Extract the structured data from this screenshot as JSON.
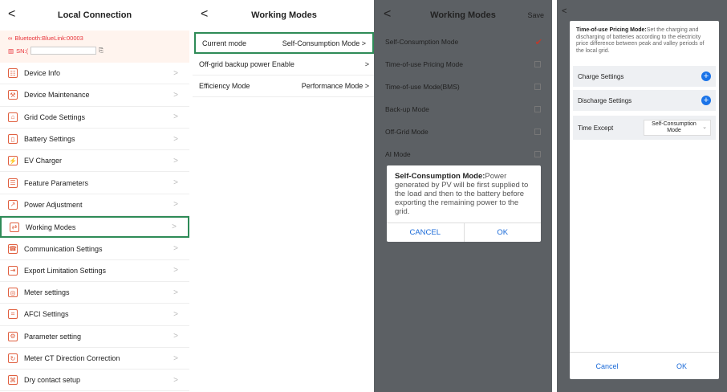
{
  "p1": {
    "title": "Local Connection",
    "back": "<",
    "bluetooth": "Bluetooth:BlueLink:00003",
    "sn_label": "SN:(",
    "items": [
      {
        "label": "Device Info",
        "icon": "☷"
      },
      {
        "label": "Device Maintenance",
        "icon": "⚒"
      },
      {
        "label": "Grid Code Settings",
        "icon": "⌂"
      },
      {
        "label": "Battery Settings",
        "icon": "▯"
      },
      {
        "label": "EV Charger",
        "icon": "⚡"
      },
      {
        "label": "Feature Parameters",
        "icon": "☰"
      },
      {
        "label": "Power Adjustment",
        "icon": "↗"
      },
      {
        "label": "Working Modes",
        "icon": "⇄"
      },
      {
        "label": "Communication Settings",
        "icon": "☎"
      },
      {
        "label": "Export Limitation Settings",
        "icon": "⇥"
      },
      {
        "label": "Meter settings",
        "icon": "◎"
      },
      {
        "label": "AFCI Settings",
        "icon": "⌗"
      },
      {
        "label": "Parameter setting",
        "icon": "⚙"
      },
      {
        "label": "Meter CT Direction Correction",
        "icon": "↻"
      },
      {
        "label": "Dry contact setup",
        "icon": "⌘"
      }
    ],
    "chevron": ">"
  },
  "p2": {
    "title": "Working Modes",
    "back": "<",
    "rows": [
      {
        "label": "Current mode",
        "value": "Self-Consumption Mode  >"
      },
      {
        "label": "Off-grid backup power Enable",
        "value": ">"
      },
      {
        "label": "Efficiency Mode",
        "value": "Performance Mode  >"
      }
    ]
  },
  "p3": {
    "title": "Working Modes",
    "back": "<",
    "save": "Save",
    "modes": [
      "Self-Consumption Mode",
      "Time-of-use Pricing Mode",
      "Time-of-use Mode(BMS)",
      "Back-up Mode",
      "Off-Grid Mode",
      "AI Mode"
    ],
    "dialog_bold": "Self-Consumption Mode:",
    "dialog_text": "Power generated by PV will be first supplied to the load and then to the battery before exporting the remaining power to the grid.",
    "cancel": "CANCEL",
    "ok": "OK"
  },
  "p4": {
    "back": "<",
    "desc_bold": "Time-of-use Pricing Mode:",
    "desc_text": "Set the charging and discharging of batteries according to the electricity price difference between peak and valley periods of the local grid.",
    "charge": "Charge Settings",
    "discharge": "Discharge Settings",
    "time_except": "Time Except",
    "time_except_value": "Self-Consumption Mode",
    "cancel": "Cancel",
    "ok": "OK"
  }
}
